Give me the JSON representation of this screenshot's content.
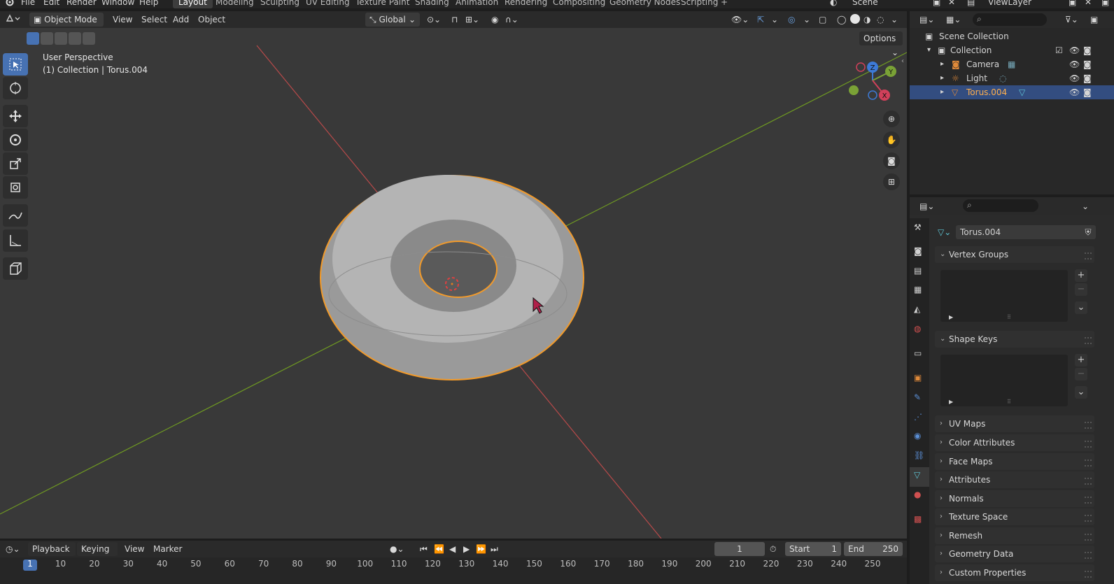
{
  "menubar": {
    "items": [
      "File",
      "Edit",
      "Render",
      "Window",
      "Help"
    ],
    "workspaces": [
      "Layout",
      "Modeling",
      "Sculpting",
      "UV Editing",
      "Texture Paint",
      "Shading",
      "Animation",
      "Rendering",
      "Compositing",
      "Geometry Nodes",
      "Scripting"
    ],
    "active_workspace": "Layout",
    "scene_name": "Scene",
    "view_layer": "ViewLayer"
  },
  "viewport_header": {
    "mode": "Object Mode",
    "menus": [
      "View",
      "Select",
      "Add",
      "Object"
    ],
    "orientation": "Global",
    "options_label": "Options"
  },
  "viewport": {
    "perspective_label": "User Perspective",
    "collection_label": "(1) Collection | Torus.004",
    "gizmo_axes": {
      "x": "X",
      "y": "Y",
      "z": "Z"
    }
  },
  "timeline": {
    "menus": [
      "Playback",
      "Keying",
      "View",
      "Marker"
    ],
    "current_frame": "1",
    "start_label": "Start",
    "start_value": "1",
    "end_label": "End",
    "end_value": "250",
    "ticks": [
      "1",
      "10",
      "20",
      "30",
      "40",
      "50",
      "60",
      "70",
      "80",
      "90",
      "100",
      "110",
      "120",
      "130",
      "140",
      "150",
      "160",
      "170",
      "180",
      "190",
      "200",
      "210",
      "220",
      "230",
      "240",
      "250"
    ]
  },
  "outliner": {
    "scene_collection": "Scene Collection",
    "collection": "Collection",
    "objects": [
      {
        "name": "Camera",
        "selected": false
      },
      {
        "name": "Light",
        "selected": false
      },
      {
        "name": "Torus.004",
        "selected": true
      }
    ]
  },
  "properties": {
    "mesh_name": "Torus.004",
    "panels": [
      {
        "label": "Vertex Groups",
        "expanded": true
      },
      {
        "label": "Shape Keys",
        "expanded": true
      },
      {
        "label": "UV Maps",
        "expanded": false
      },
      {
        "label": "Color Attributes",
        "expanded": false
      },
      {
        "label": "Face Maps",
        "expanded": false
      },
      {
        "label": "Attributes",
        "expanded": false
      },
      {
        "label": "Normals",
        "expanded": false
      },
      {
        "label": "Texture Space",
        "expanded": false
      },
      {
        "label": "Remesh",
        "expanded": false
      },
      {
        "label": "Geometry Data",
        "expanded": false
      },
      {
        "label": "Custom Properties",
        "expanded": false
      }
    ]
  },
  "colors": {
    "accent": "#4772b3",
    "selection_outline": "#f19a2b",
    "x_axis": "#b84a4a",
    "y_axis": "#6f9a22",
    "selected_text": "#ffaf4d"
  }
}
